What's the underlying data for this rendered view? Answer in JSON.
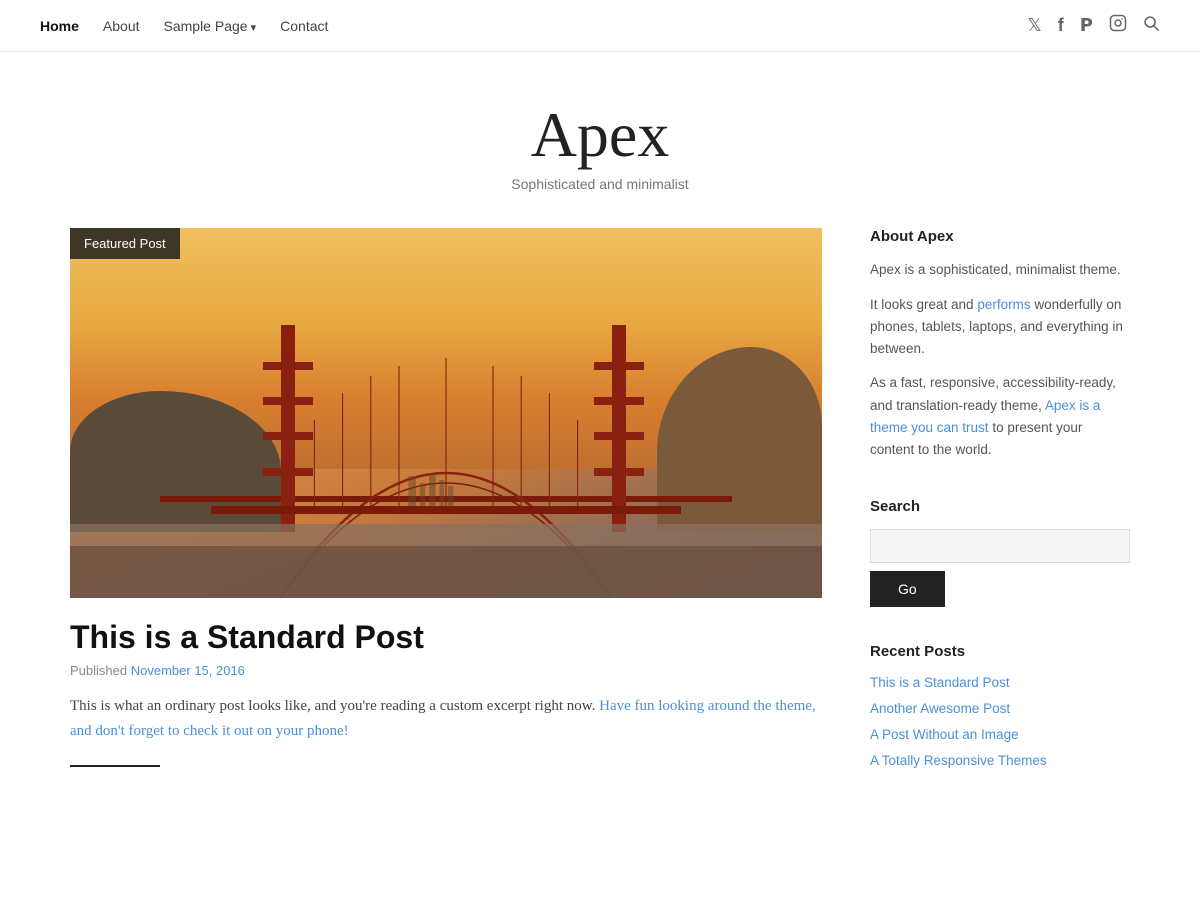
{
  "nav": {
    "items": [
      {
        "label": "Home",
        "active": true,
        "hasArrow": false
      },
      {
        "label": "About",
        "active": false,
        "hasArrow": false
      },
      {
        "label": "Sample Page",
        "active": false,
        "hasArrow": true
      },
      {
        "label": "Contact",
        "active": false,
        "hasArrow": false
      }
    ],
    "icons": [
      {
        "name": "twitter-icon",
        "glyph": "𝕏"
      },
      {
        "name": "facebook-icon",
        "glyph": "f"
      },
      {
        "name": "pinterest-icon",
        "glyph": "𝗣"
      },
      {
        "name": "instagram-icon",
        "glyph": "◻"
      },
      {
        "name": "search-icon",
        "glyph": "🔍"
      }
    ]
  },
  "header": {
    "title": "Apex",
    "tagline": "Sophisticated and minimalist"
  },
  "featured": {
    "badge": "Featured Post"
  },
  "post": {
    "title": "This is a Standard Post",
    "meta_prefix": "Published",
    "date": "November 15, 2016",
    "excerpt": "This is what an ordinary post looks like, and you're reading a custom excerpt right now. Have fun looking around the theme, and don't forget to check it out on your phone!"
  },
  "sidebar": {
    "about_title": "About Apex",
    "about_p1": "Apex is a sophisticated, minimalist theme.",
    "about_p2": "It looks great and performs wonderfully on phones, tablets, laptops, and everything in between.",
    "about_p3": "As a fast, responsive, accessibility-ready, and translation-ready theme, Apex is a theme you can trust to present your content to the world.",
    "search_title": "Search",
    "search_placeholder": "",
    "search_button": "Go",
    "recent_title": "Recent Posts",
    "recent_posts": [
      {
        "label": "This is a Standard Post"
      },
      {
        "label": "Another Awesome Post"
      },
      {
        "label": "A Post Without an Image"
      },
      {
        "label": "A Totally Responsive Themes"
      }
    ]
  }
}
